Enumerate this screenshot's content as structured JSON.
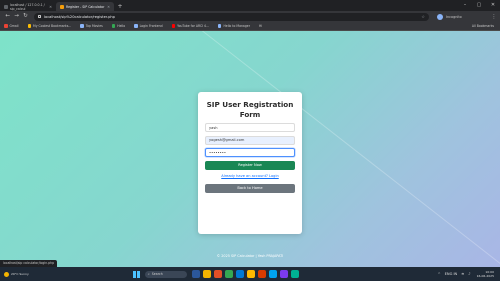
{
  "browser": {
    "tabs": [
      {
        "title": "localhost / 127.0.0.1 / sip_calcul",
        "active": false
      },
      {
        "title": "Register - SIP Calculator",
        "active": true
      }
    ],
    "new_tab": "+",
    "window_controls": {
      "minimize": "–",
      "maximize": "▢",
      "close": "✕"
    },
    "nav": {
      "back": "←",
      "forward": "→",
      "reload": "↻"
    },
    "url": "localhost/sip%20calculator/register.php",
    "incognito_label": "Incognito",
    "bookmarks": [
      "Gmail",
      "My Coolest Bookmarks...",
      "Top Movies",
      "Hello",
      "Login Frontend",
      "YouTube for ARCI 4...",
      "Hello to Manager",
      "Hi"
    ],
    "all_bookmarks": "All Bookmarks"
  },
  "form": {
    "title": "SIP User Registration Form",
    "username_value": "yash",
    "email_value": "yogesh@gmail.com",
    "password_value": "••••••••",
    "register_label": "Register Now",
    "login_link": "Already have an account? Login",
    "home_label": "Back to Home"
  },
  "footer": "© 2025 SIP Calculator | Yash PRAJAPATI",
  "status_url": "localhost/sip calculator/login.php",
  "taskbar": {
    "weather": "29°C Sunny",
    "search_placeholder": "Search",
    "app_colors": [
      "#2b579a",
      "#f4b400",
      "#e34f26",
      "#34a853",
      "#0078d4",
      "#ffb900",
      "#d83b01",
      "#00a4ef",
      "#7c3aed",
      "#00b294"
    ],
    "lang": "ENG IN",
    "time": "10:00",
    "date": "16-06-2025"
  },
  "colors": {
    "register": "#198754",
    "home": "#6c757d",
    "link": "#0d6efd",
    "bg_start": "#7ee3c9",
    "bg_end": "#a9b6e6"
  }
}
